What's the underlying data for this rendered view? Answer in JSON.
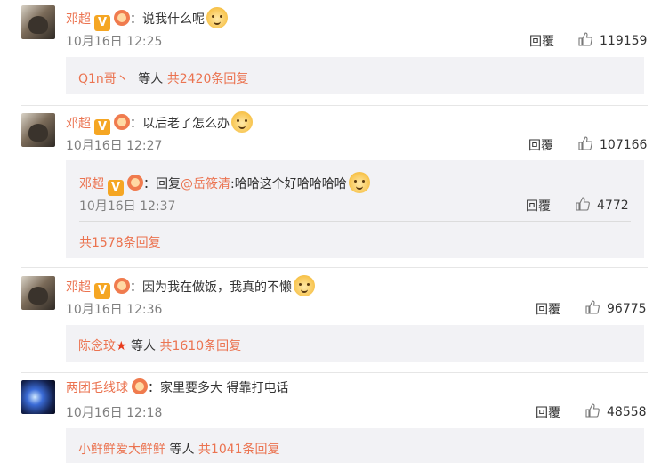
{
  "comments": [
    {
      "user": "邓超",
      "text": "：说我什么呢",
      "time": "10月16日 12:25",
      "reply_label": "回覆",
      "likes": "119159",
      "sub_users": "Q1n哥丶",
      "sub_deng": "等人",
      "sub_count": "共2420条回复"
    },
    {
      "user": "邓超",
      "text": "：以后老了怎么办",
      "time": "10月16日 12:27",
      "reply_label": "回覆",
      "likes": "107166",
      "nested": {
        "user": "邓超",
        "reply_prefix": "：回复",
        "mention": "@岳筱清",
        "text": ":哈哈这个好哈哈哈哈",
        "time": "10月16日 12:37",
        "reply_label": "回覆",
        "likes": "4772"
      },
      "sub_count": "共1578条回复"
    },
    {
      "user": "邓超",
      "text": "：因为我在做饭，我真的不懒",
      "time": "10月16日 12:36",
      "reply_label": "回覆",
      "likes": "96775",
      "sub_users": "陈念玟",
      "sub_deng": "等人",
      "sub_count": "共1610条回复"
    },
    {
      "user": "两团毛线球",
      "text": "：家里要多大 得靠打电话",
      "time": "10月16日 12:18",
      "reply_label": "回覆",
      "likes": "48558",
      "sub_users": "小鲜鲜爱大鲜鲜",
      "sub_deng": "等人",
      "sub_count": "共1041条回复"
    }
  ],
  "colors": {
    "accent": "#eb7350",
    "sub_bg": "#f2f2f5",
    "time": "#808080"
  }
}
